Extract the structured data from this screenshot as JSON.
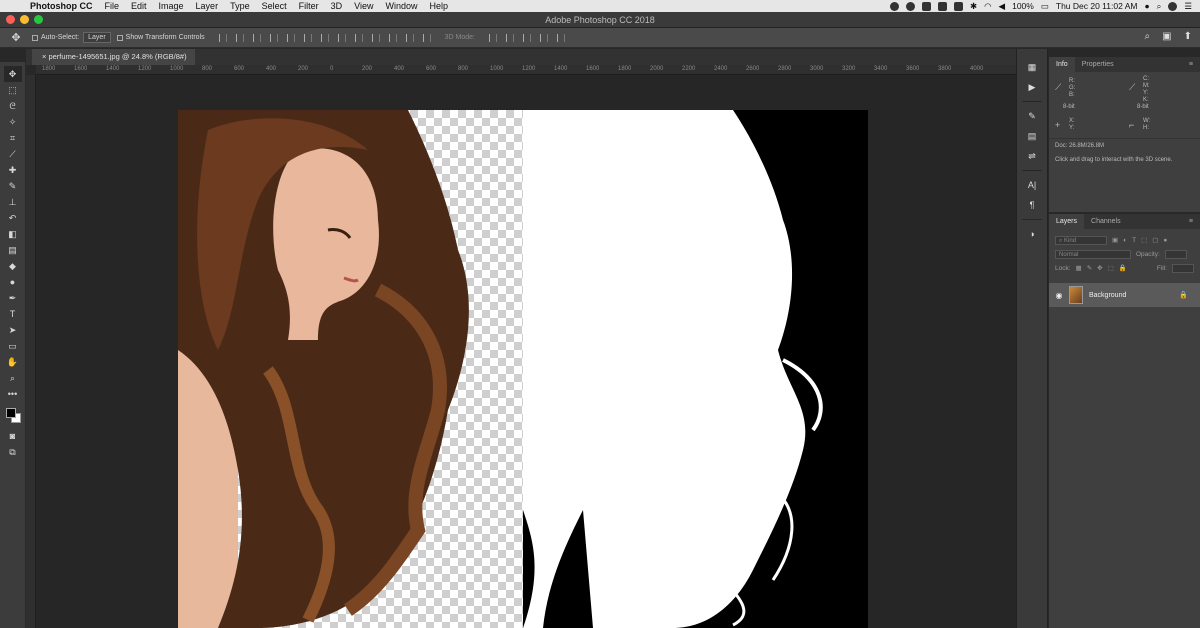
{
  "menubar": {
    "items": [
      "Photoshop CC",
      "File",
      "Edit",
      "Image",
      "Layer",
      "Type",
      "Select",
      "Filter",
      "3D",
      "View",
      "Window",
      "Help"
    ],
    "battery": "100%",
    "datetime": "Thu Dec 20  11:02 AM"
  },
  "window": {
    "title": "Adobe Photoshop CC 2018"
  },
  "options": {
    "auto_select": "Auto-Select:",
    "auto_select_value": "Layer",
    "show_transform": "Show Transform Controls",
    "mode_3d": "3D Mode:"
  },
  "document": {
    "tab_label": "perfume-1495651.jpg @ 24.8% (RGB/8#)"
  },
  "ruler": {
    "ticks": [
      "1800",
      "1600",
      "1400",
      "1200",
      "1000",
      "800",
      "600",
      "400",
      "200",
      "0",
      "200",
      "400",
      "600",
      "800",
      "1000",
      "1200",
      "1400",
      "1600",
      "1800",
      "2000",
      "2200",
      "2400",
      "2600",
      "2800",
      "3000",
      "3200",
      "3400",
      "3600",
      "3800",
      "4000"
    ]
  },
  "info_panel": {
    "tabs": [
      "Info",
      "Properties"
    ],
    "rgb_labels": [
      "R:",
      "G:",
      "B:"
    ],
    "cmyk_labels": [
      "C:",
      "M:",
      "Y:",
      "K:"
    ],
    "bit_left": "8-bit",
    "bit_right": "8-bit",
    "xy_labels": [
      "X:",
      "Y:"
    ],
    "wh_labels": [
      "W:",
      "H:"
    ],
    "doc_size": "Doc: 26.8M/26.8M",
    "hint": "Click and drag to interact with the 3D scene."
  },
  "layers_panel": {
    "tabs": [
      "Layers",
      "Channels"
    ],
    "kind": "Kind",
    "blend_mode": "Normal",
    "opacity_label": "Opacity:",
    "lock_label": "Lock:",
    "fill_label": "Fill:",
    "layer_name": "Background"
  }
}
